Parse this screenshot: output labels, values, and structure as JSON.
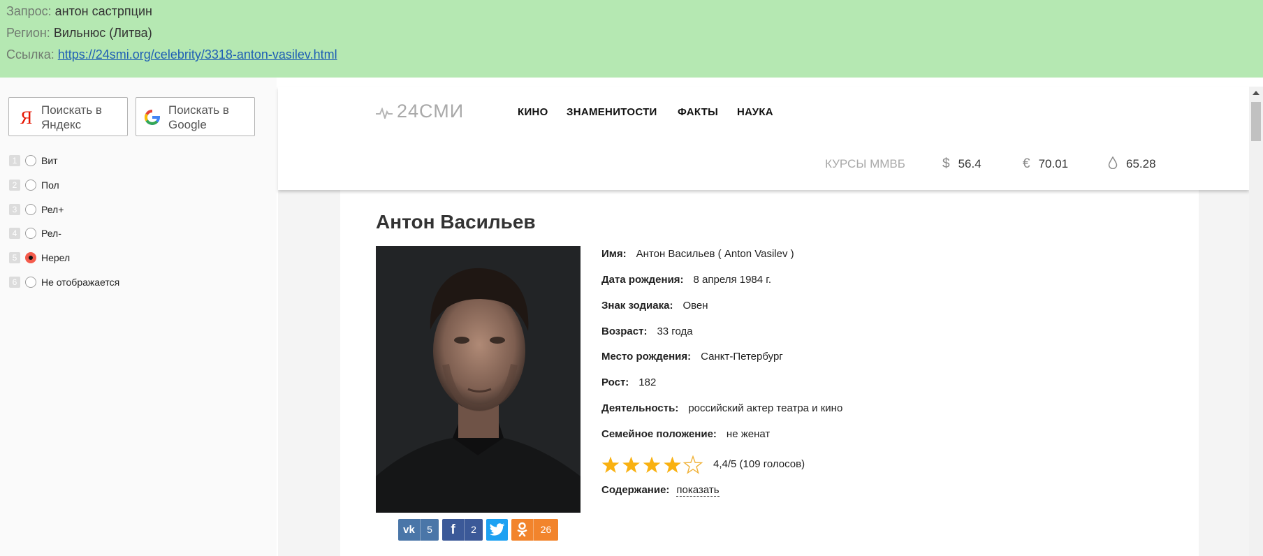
{
  "topbar": {
    "query_label": "Запрос:",
    "query_value": "антон састрпцин",
    "region_label": "Регион:",
    "region_value": "Вильнюс (Литва)",
    "link_label": "Ссылка:",
    "link_value": "https://24smi.org/celebrity/3318-anton-vasilev.html"
  },
  "search_buttons": {
    "yandex": "Поискать в Яндекс",
    "google": "Поискать в Google"
  },
  "options": [
    {
      "num": "1",
      "label": "Вит",
      "selected": false
    },
    {
      "num": "2",
      "label": "Пол",
      "selected": false
    },
    {
      "num": "3",
      "label": "Рел+",
      "selected": false
    },
    {
      "num": "4",
      "label": "Рел-",
      "selected": false
    },
    {
      "num": "5",
      "label": "Нерел",
      "selected": true
    },
    {
      "num": "6",
      "label": "Не отображается",
      "selected": false
    }
  ],
  "site": {
    "logo": "24СМИ",
    "nav": [
      "КИНО",
      "ЗНАМЕНИТОСТИ",
      "ФАКТЫ",
      "НАУКА"
    ],
    "rates_label": "КУРСЫ ММВБ",
    "rates": [
      {
        "symbol": "$",
        "value": "56.4"
      },
      {
        "symbol": "€",
        "value": "70.01"
      },
      {
        "symbol": "oil-drop-icon",
        "value": "65.28"
      }
    ]
  },
  "article": {
    "title": "Антон Васильев",
    "info": [
      {
        "label": "Имя:",
        "value": "Антон Васильев ( Anton Vasilev )"
      },
      {
        "label": "Дата рождения:",
        "value": "8 апреля 1984 г."
      },
      {
        "label": "Знак зодиака:",
        "value": "Овен"
      },
      {
        "label": "Возраст:",
        "value": "33 года"
      },
      {
        "label": "Место рождения:",
        "value": "Санкт-Петербург"
      },
      {
        "label": "Рост:",
        "value": "182"
      },
      {
        "label": "Деятельность:",
        "value": "российский актер театра и кино"
      },
      {
        "label": "Семейное положение:",
        "value": "не женат"
      }
    ],
    "rating": {
      "stars_filled": 4,
      "stars_total": 5,
      "text": "4,4/5 (109 голосов)"
    },
    "content_label": "Содержание:",
    "content_link": "показать",
    "social": [
      {
        "network": "vk-icon",
        "count": "5",
        "color": "#4a76a8"
      },
      {
        "network": "facebook-icon",
        "count": "2",
        "color": "#3b5998"
      },
      {
        "network": "twitter-icon",
        "count": "",
        "color": "#1da1f2"
      },
      {
        "network": "odnoklassniki-icon",
        "count": "26",
        "color": "#f2842c"
      }
    ]
  }
}
